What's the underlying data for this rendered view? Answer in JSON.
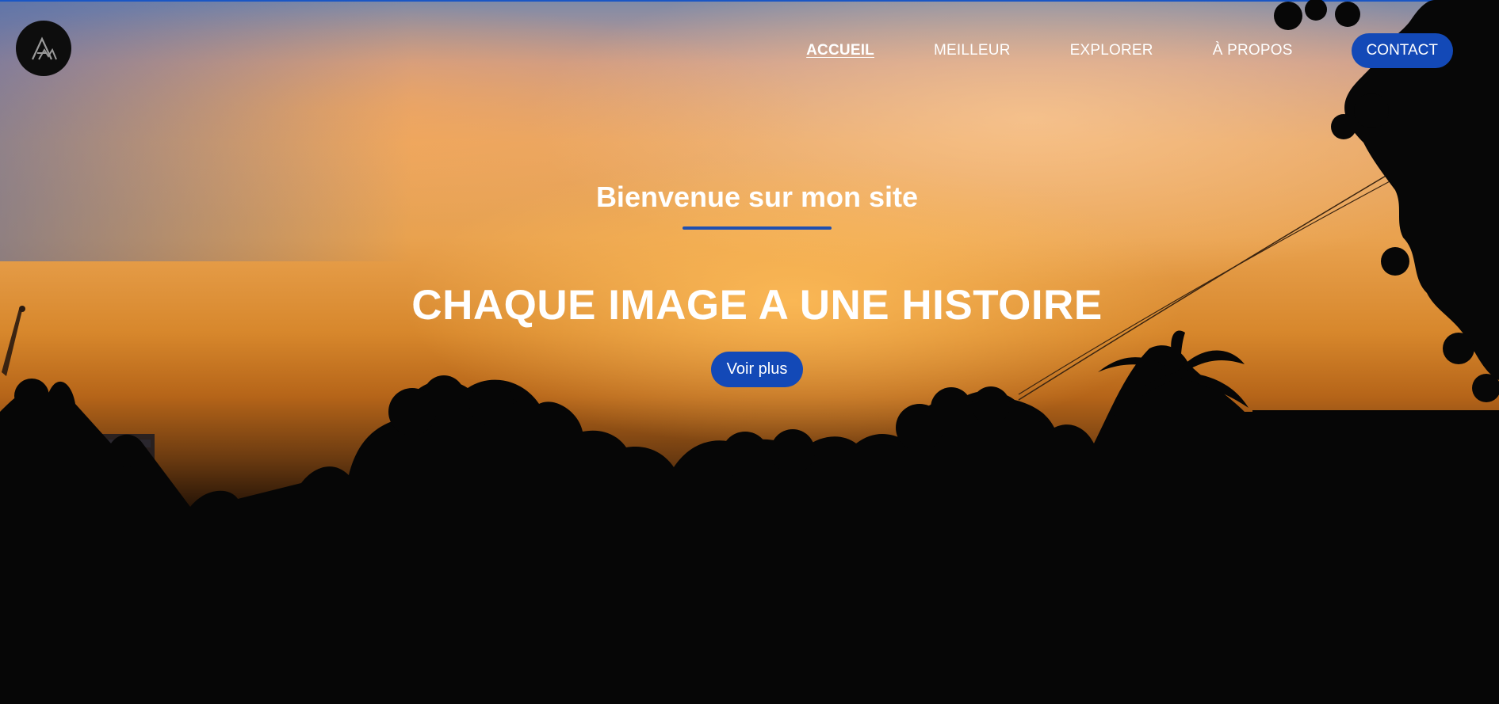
{
  "header": {
    "logo_icon": "am-monogram-logo-icon",
    "nav": [
      {
        "label": "ACCUEIL",
        "active": true
      },
      {
        "label": "MEILLEUR",
        "active": false
      },
      {
        "label": "EXPLORER",
        "active": false
      },
      {
        "label": "À PROPOS",
        "active": false
      }
    ],
    "contact_label": "CONTACT"
  },
  "hero": {
    "welcome": "Bienvenue sur mon site",
    "tagline": "CHAQUE IMAGE A UNE HISTOIRE",
    "cta_label": "Voir plus"
  },
  "colors": {
    "accent": "#1349b7",
    "accent_bar": "#1f4fb0",
    "text": "#ffffff",
    "logo_bg": "#0d0d0d"
  }
}
